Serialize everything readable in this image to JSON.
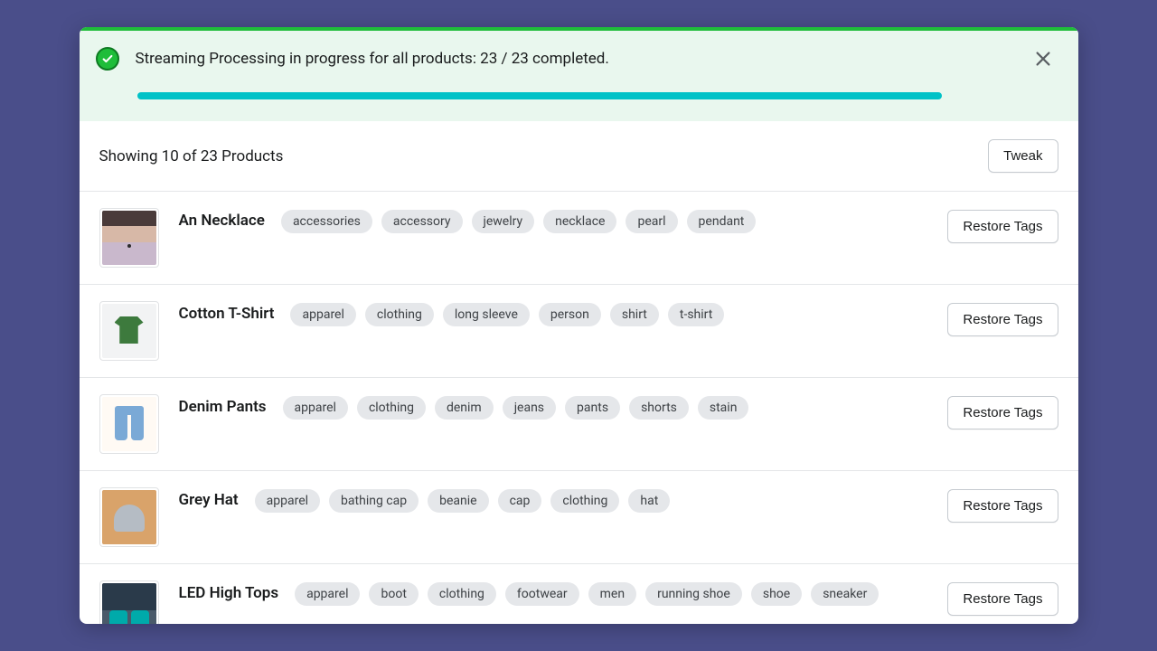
{
  "banner": {
    "message": "Streaming Processing in progress for all products: 23 / 23 completed."
  },
  "header": {
    "showing_text": "Showing 10 of 23 Products",
    "tweak_label": "Tweak"
  },
  "restore_label": "Restore Tags",
  "products": [
    {
      "title": "An Necklace",
      "thumb_class": "thumb-necklace",
      "frame_padding": "0px",
      "tags": [
        "accessories",
        "accessory",
        "jewelry",
        "necklace",
        "pearl",
        "pendant"
      ]
    },
    {
      "title": "Cotton T-Shirt",
      "thumb_class": "thumb-tshirt",
      "frame_padding": "2px",
      "tags": [
        "apparel",
        "clothing",
        "long sleeve",
        "person",
        "shirt",
        "t-shirt"
      ]
    },
    {
      "title": "Denim Pants",
      "thumb_class": "thumb-jeans",
      "frame_padding": "2px",
      "tags": [
        "apparel",
        "clothing",
        "denim",
        "jeans",
        "pants",
        "shorts",
        "stain"
      ]
    },
    {
      "title": "Grey Hat",
      "thumb_class": "thumb-hat",
      "frame_padding": "2px",
      "tags": [
        "apparel",
        "bathing cap",
        "beanie",
        "cap",
        "clothing",
        "hat"
      ]
    },
    {
      "title": "LED High Tops",
      "thumb_class": "thumb-shoes",
      "frame_padding": "2px",
      "tags": [
        "apparel",
        "boot",
        "clothing",
        "footwear",
        "men",
        "running shoe",
        "shoe",
        "sneaker"
      ]
    }
  ]
}
